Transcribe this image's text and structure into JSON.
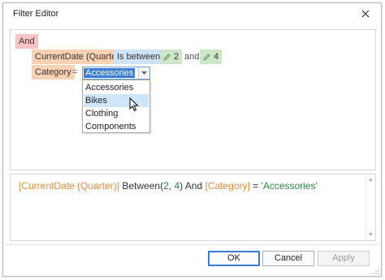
{
  "window": {
    "title": "Filter Editor"
  },
  "tree": {
    "group": "And",
    "condition1": {
      "field": "CurrentDate (Quarter)",
      "operator": "Is between",
      "value1": "2",
      "joiner": "and",
      "value2": "4"
    },
    "condition2": {
      "field": "Category",
      "operator": "=",
      "value": "Accessories"
    }
  },
  "dropdown": {
    "options": [
      "Accessories",
      "Bikes",
      "Clothing",
      "Components"
    ],
    "hovered": "Bikes"
  },
  "expression": {
    "f1": "[CurrentDate (Quarter)]",
    "op1": " Between(",
    "n1": "2",
    "sep": ", ",
    "n2": "4",
    "op2": ") And ",
    "f2": "[Category]",
    "op3": " = ",
    "s1": "'Accessories'"
  },
  "buttons": {
    "ok": "OK",
    "cancel": "Cancel",
    "apply": "Apply"
  },
  "colors": {
    "group": "#f6c4c4",
    "field": "#f9d2b4",
    "operator": "#cfe3f6",
    "value": "#cde6c8",
    "accent": "#3a7bd5"
  }
}
